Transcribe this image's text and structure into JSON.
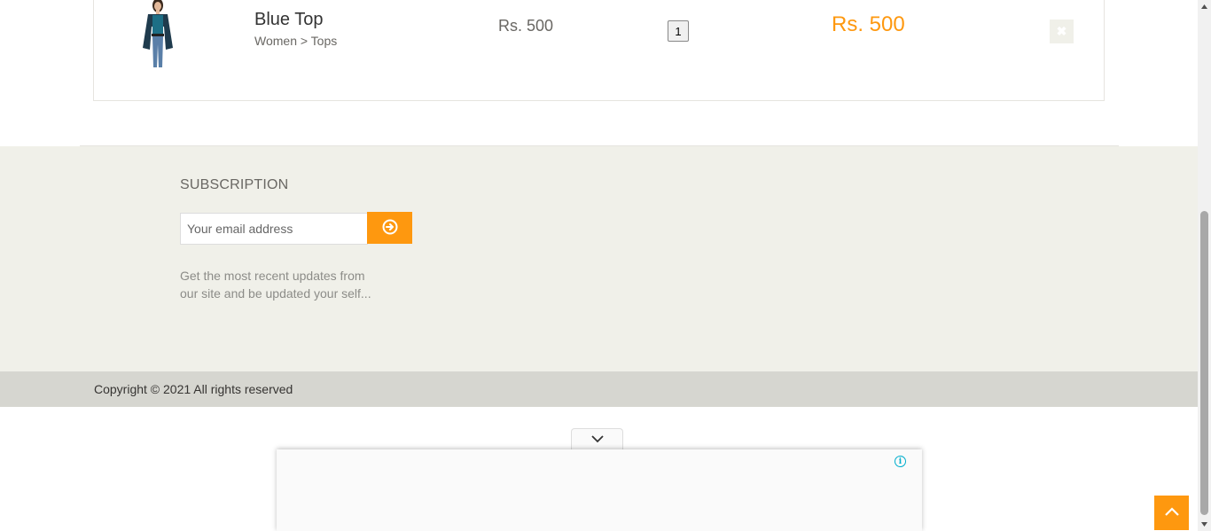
{
  "cart": {
    "item": {
      "name": "Blue Top",
      "category": "Women > Tops",
      "price": "Rs. 500",
      "quantity": "1",
      "total": "Rs. 500",
      "image_icon": "product-image-woman-blue-top",
      "delete_icon": "close-icon"
    }
  },
  "footer": {
    "subscription_title": "SUBSCRIPTION",
    "email_placeholder": "Your email address",
    "subscribe_icon": "arrow-circle-right-icon",
    "description": "Get the most recent updates from our site and be updated your self...",
    "copyright": "Copyright © 2021 All rights reserved"
  },
  "ad": {
    "collapse_icon": "chevron-down-icon",
    "info_icon": "info-icon",
    "info_glyph": "i"
  },
  "scroll_up_icon": "chevron-up-icon",
  "colors": {
    "accent": "#fe980f",
    "footer_bg": "#f0f0e9",
    "footer_bottom_bg": "#d6d6d0"
  }
}
